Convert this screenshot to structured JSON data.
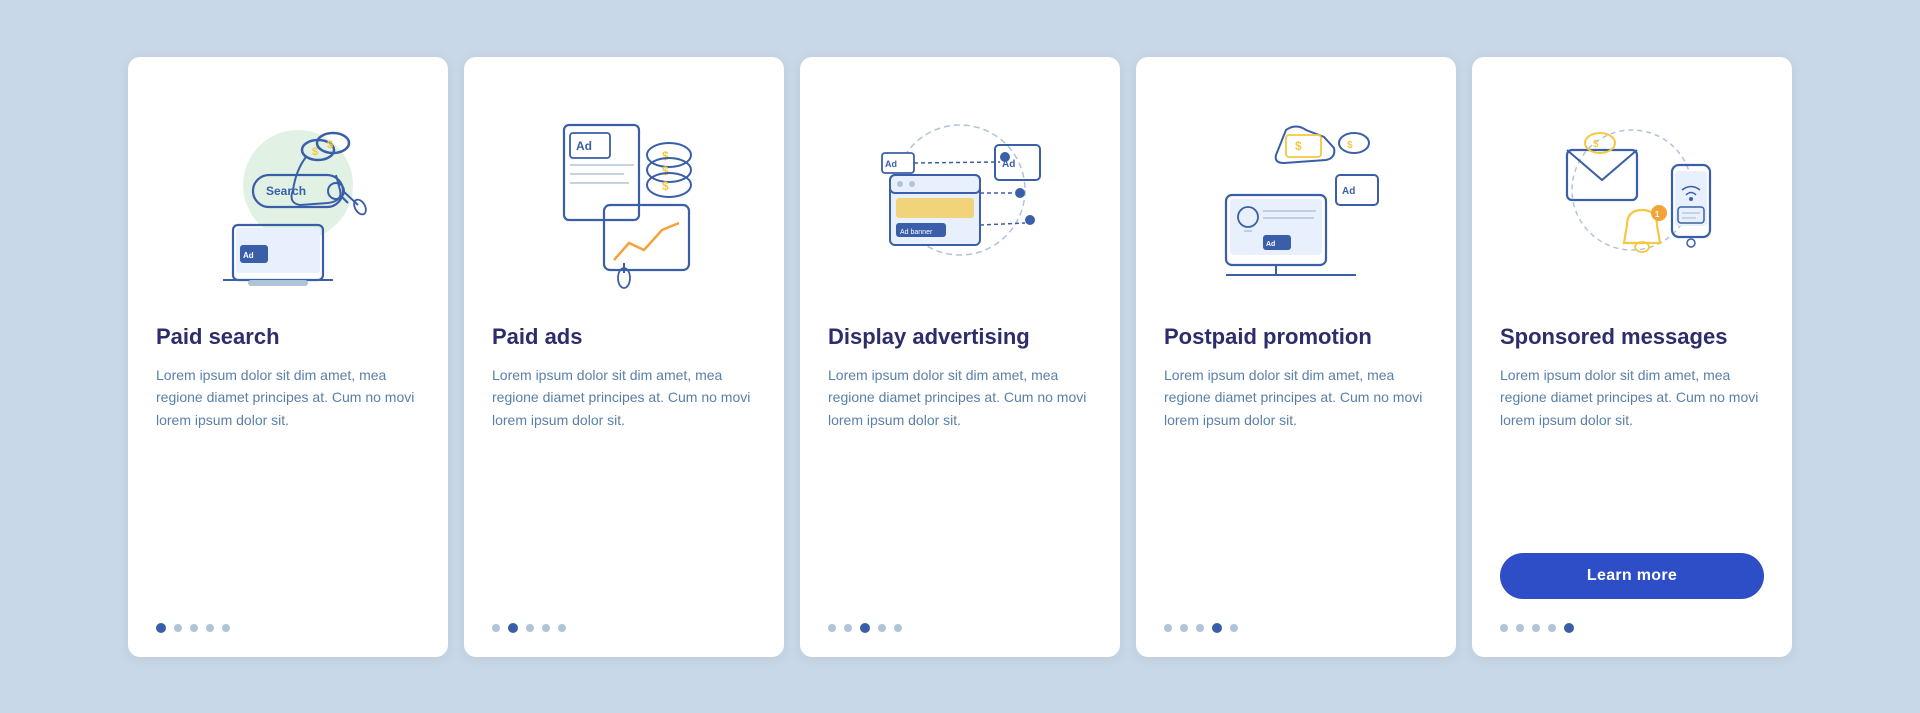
{
  "cards": [
    {
      "id": "paid-search",
      "title": "Paid search",
      "body": "Lorem ipsum dolor sit dim amet, mea regione diamet principes at. Cum no movi lorem ipsum dolor sit.",
      "dots": [
        1,
        0,
        0,
        0,
        0
      ],
      "active_dot": 0,
      "show_button": false,
      "button_label": ""
    },
    {
      "id": "paid-ads",
      "title": "Paid ads",
      "body": "Lorem ipsum dolor sit dim amet, mea regione diamet principes at. Cum no movi lorem ipsum dolor sit.",
      "dots": [
        0,
        1,
        0,
        0,
        0
      ],
      "active_dot": 1,
      "show_button": false,
      "button_label": ""
    },
    {
      "id": "display-advertising",
      "title": "Display advertising",
      "body": "Lorem ipsum dolor sit dim amet, mea regione diamet principes at. Cum no movi lorem ipsum dolor sit.",
      "dots": [
        0,
        0,
        1,
        0,
        0
      ],
      "active_dot": 2,
      "show_button": false,
      "button_label": ""
    },
    {
      "id": "postpaid-promotion",
      "title": "Postpaid promotion",
      "body": "Lorem ipsum dolor sit dim amet, mea regione diamet principes at. Cum no movi lorem ipsum dolor sit.",
      "dots": [
        0,
        0,
        0,
        1,
        0
      ],
      "active_dot": 3,
      "show_button": false,
      "button_label": ""
    },
    {
      "id": "sponsored-messages",
      "title": "Sponsored messages",
      "body": "Lorem ipsum dolor sit dim amet, mea regione diamet principes at. Cum no movi lorem ipsum dolor sit.",
      "dots": [
        0,
        0,
        0,
        0,
        1
      ],
      "active_dot": 4,
      "show_button": true,
      "button_label": "Learn more"
    }
  ],
  "colors": {
    "accent_blue": "#3a5fa8",
    "dark_blue": "#2d2d6b",
    "text_blue": "#5a7fa8",
    "btn_blue": "#2d4ec7",
    "dot_inactive": "#b0c4d8",
    "green_accent": "#b8e0b8",
    "yellow_accent": "#f5c842",
    "orange_accent": "#f4a23a"
  }
}
